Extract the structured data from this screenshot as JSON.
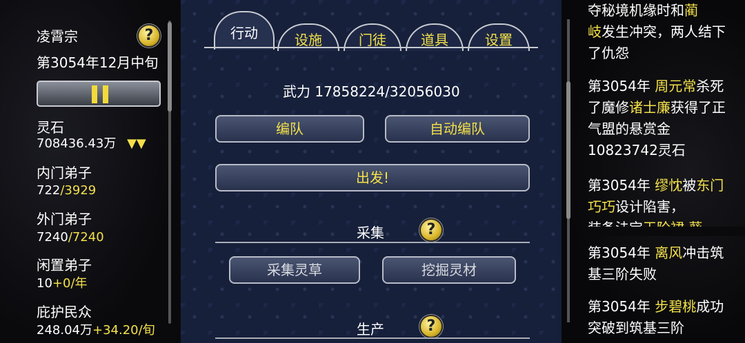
{
  "left": {
    "sect_name": "凌霄宗",
    "date": "第3054年12月中旬",
    "stats": [
      {
        "label": "灵石",
        "value": "708436.43万",
        "extra": "▼▼"
      },
      {
        "label": "内门弟子",
        "current": "722",
        "max": "/3929"
      },
      {
        "label": "外门弟子",
        "current": "7240",
        "max": "/7240"
      },
      {
        "label": "闲置弟子",
        "current": "10",
        "max": "+0/年"
      },
      {
        "label": "庇护民众",
        "current": "248.04万",
        "max": "+34.20/旬"
      }
    ],
    "help_icon": "question-mark"
  },
  "tabs": [
    "行动",
    "设施",
    "门徒",
    "道具",
    "设置"
  ],
  "center": {
    "power_label": "武力 17858224/32056030",
    "team_button": "编队",
    "auto_team_button": "自动编队",
    "depart_button": "出发!",
    "gather_title": "采集",
    "gather_herb_button": "采集灵草",
    "mine_button": "挖掘灵材",
    "produce_title": "生产"
  },
  "log": {
    "entry0_a": "夺秘境机缘时和",
    "entry0_b": "蔺",
    "entry0_c": "岐",
    "entry0_d": "发生冲突，两人结下了仇怨",
    "entry1_year": "第3054年 ",
    "entry1_name1": "周元常",
    "entry1_mid": "杀死了魔修",
    "entry1_name2": "诸士廉",
    "entry1_end": "获得了正气盟的悬赏金10823742灵石",
    "entry2_year": "第3054年 ",
    "entry2_name1": "缪忱",
    "entry2_mid": "被",
    "entry2_name2": "东门巧巧",
    "entry2_end": "设计陷害，",
    "entry2_cut_a": "装备法宝",
    "entry2_cut_b": "天阶裙·葵",
    "entry3_year": "第3054年 ",
    "entry3_name": "离风",
    "entry3_end": "冲击筑基三阶失败",
    "entry4_year": "第3054年 ",
    "entry4_name": "步碧桃",
    "entry4_end": "成功突破到筑基三阶"
  },
  "colors": {
    "accent": "#f3e04a",
    "panel": "#16203a"
  }
}
